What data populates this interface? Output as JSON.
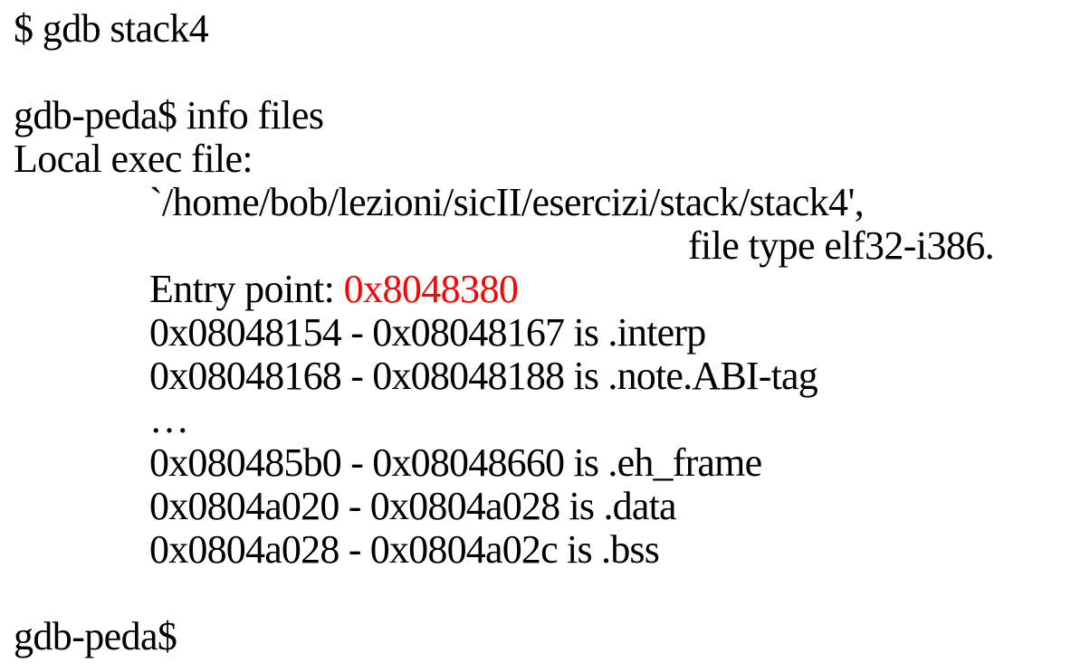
{
  "terminal": {
    "shell_command": "$ gdb stack4",
    "info_files_command": "gdb-peda$ info files",
    "local_exec_label": "Local exec file:",
    "exec_path": "`/home/bob/lezioni/sicII/esercizi/stack/stack4',",
    "file_type": "file type elf32-i386.",
    "entry_point_label": "Entry point: ",
    "entry_point_value": "0x8048380",
    "sections": [
      "0x08048154 - 0x08048167 is .interp",
      "0x08048168 - 0x08048188 is .note.ABI-tag",
      "…",
      "0x080485b0 - 0x08048660 is .eh_frame",
      "0x0804a020 - 0x0804a028 is .data",
      "0x0804a028 - 0x0804a02c is .bss"
    ],
    "final_prompt": "gdb-peda$"
  },
  "colors": {
    "text": "#000000",
    "highlight": "#ff0000",
    "background": "#ffffff"
  }
}
